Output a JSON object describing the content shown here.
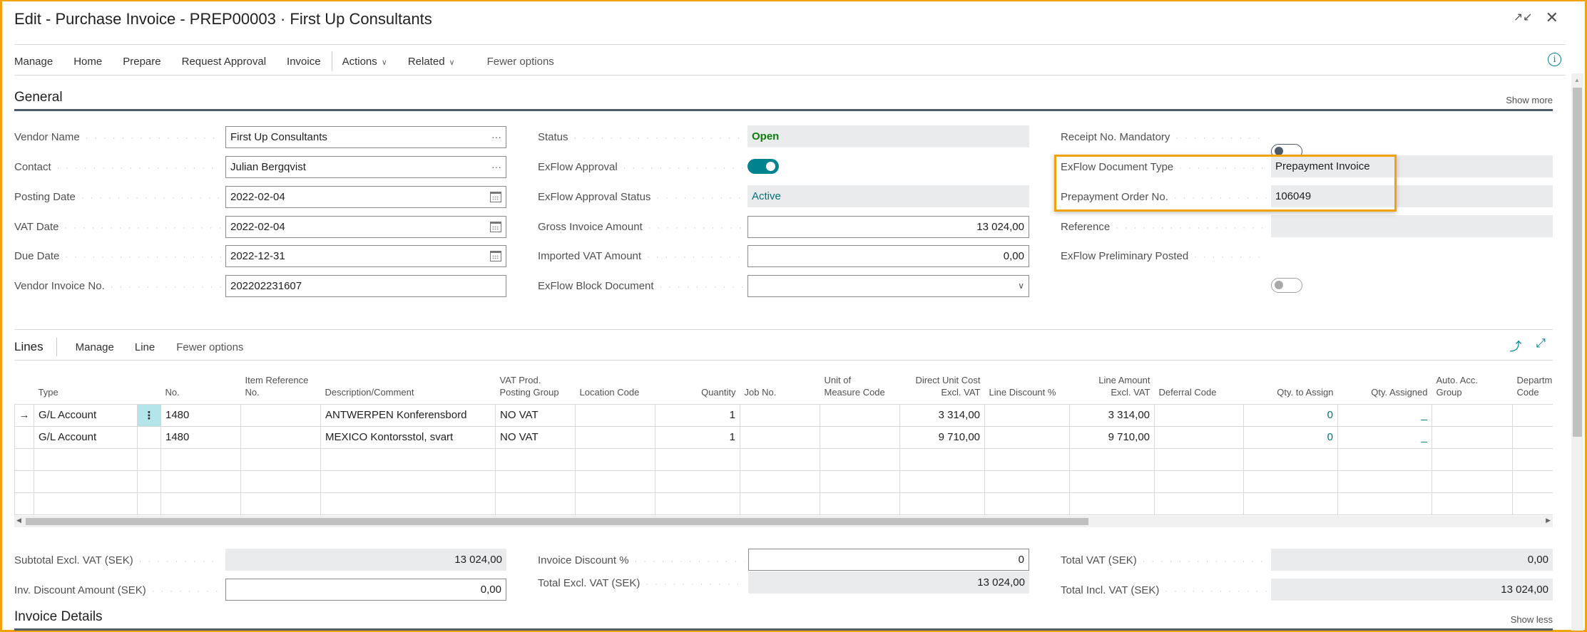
{
  "window": {
    "title": "Edit - Purchase Invoice - PREP00003 · First Up Consultants",
    "collapse_icon": "↘↖",
    "close_icon": "✕"
  },
  "actionbar": {
    "items": [
      "Manage",
      "Home",
      "Prepare",
      "Request Approval",
      "Invoice"
    ],
    "dropdowns": [
      "Actions",
      "Related"
    ],
    "fewer_options": "Fewer options",
    "chevron": "∨",
    "info_icon": "i"
  },
  "general": {
    "title": "General",
    "show_more": "Show more",
    "col1": [
      {
        "label": "Vendor Name",
        "value": "First Up Consultants",
        "suffix": "···"
      },
      {
        "label": "Contact",
        "value": "Julian Bergqvist",
        "suffix": "···"
      },
      {
        "label": "Posting Date",
        "value": "2022-02-04"
      },
      {
        "label": "VAT Date",
        "value": "2022-02-04"
      },
      {
        "label": "Due Date",
        "value": "2022-12-31"
      },
      {
        "label": "Vendor Invoice No.",
        "value": "202202231607"
      }
    ],
    "col2": [
      {
        "label": "Status",
        "value": "Open"
      },
      {
        "label": "ExFlow Approval",
        "value": true
      },
      {
        "label": "ExFlow Approval Status",
        "value": "Active"
      },
      {
        "label": "Gross Invoice Amount",
        "value": "13 024,00"
      },
      {
        "label": "Imported VAT Amount",
        "value": "0,00"
      },
      {
        "label": "ExFlow Block Document",
        "value": "",
        "chevron": "∨"
      }
    ],
    "col3": [
      {
        "label": "Receipt No. Mandatory",
        "value": false
      },
      {
        "label": "ExFlow Document Type",
        "value": "Prepayment Invoice"
      },
      {
        "label": "Prepayment Order No.",
        "value": "106049"
      },
      {
        "label": "Reference",
        "value": ""
      },
      {
        "label": "ExFlow Preliminary Posted",
        "value": false
      }
    ]
  },
  "lines": {
    "title": "Lines",
    "actions": [
      "Manage",
      "Line",
      "Fewer options"
    ],
    "share_icon": "⤴",
    "expand_icon": "⤢",
    "columns": [
      {
        "line1": "",
        "line2": "Type"
      },
      {
        "line1": "",
        "line2": ""
      },
      {
        "line1": "",
        "line2": "No."
      },
      {
        "line1": "Item Reference",
        "line2": "No."
      },
      {
        "line1": "",
        "line2": "Description/Comment"
      },
      {
        "line1": "VAT Prod.",
        "line2": "Posting Group"
      },
      {
        "line1": "",
        "line2": "Location Code"
      },
      {
        "line1": "",
        "line2": "Quantity"
      },
      {
        "line1": "",
        "line2": "Job No."
      },
      {
        "line1": "Unit of",
        "line2": "Measure Code"
      },
      {
        "line1": "Direct Unit Cost",
        "line2": "Excl. VAT"
      },
      {
        "line1": "",
        "line2": "Line Discount %"
      },
      {
        "line1": "Line Amount",
        "line2": "Excl. VAT"
      },
      {
        "line1": "",
        "line2": "Deferral Code"
      },
      {
        "line1": "",
        "line2": "Qty. to Assign"
      },
      {
        "line1": "",
        "line2": "Qty. Assigned"
      },
      {
        "line1": "Auto. Acc.",
        "line2": "Group"
      },
      {
        "line1": "Departm",
        "line2": "Code"
      }
    ],
    "rows": [
      {
        "arrow": "→",
        "menu": "⋮",
        "type": "G/L Account",
        "no": "1480",
        "item_ref": "",
        "description": "ANTWERPEN Konferensbord",
        "vat_prod": "NO VAT",
        "location": "",
        "quantity": "1",
        "job_no": "",
        "uom": "",
        "unit_cost": "3 314,00",
        "line_disc": "",
        "line_amount": "3 314,00",
        "deferral": "",
        "qty_to_assign": "0",
        "qty_assigned": "_",
        "auto_acc": "",
        "dept": ""
      },
      {
        "arrow": "",
        "menu": "",
        "type": "G/L Account",
        "no": "1480",
        "item_ref": "",
        "description": "MEXICO Kontorsstol, svart",
        "vat_prod": "NO VAT",
        "location": "",
        "quantity": "1",
        "job_no": "",
        "uom": "",
        "unit_cost": "9 710,00",
        "line_disc": "",
        "line_amount": "9 710,00",
        "deferral": "",
        "qty_to_assign": "0",
        "qty_assigned": "_",
        "auto_acc": "",
        "dept": ""
      }
    ],
    "empty_rows": 3
  },
  "totals": {
    "subtotal_label": "Subtotal Excl. VAT (SEK)",
    "subtotal": "13 024,00",
    "inv_disc_amount_label": "Inv. Discount Amount (SEK)",
    "inv_disc_amount": "0,00",
    "inv_disc_pct_label": "Invoice Discount %",
    "inv_disc_pct": "0",
    "total_excl_label": "Total Excl. VAT (SEK)",
    "total_excl": "13 024,00",
    "total_vat_label": "Total VAT (SEK)",
    "total_vat": "0,00",
    "total_incl_label": "Total Incl. VAT (SEK)",
    "total_incl": "13 024,00"
  },
  "invoice_details": {
    "title": "Invoice Details",
    "show_less": "Show less"
  },
  "colors": {
    "accent": "#00838f",
    "highlight": "#f0a30a",
    "status_open": "#107c10"
  }
}
